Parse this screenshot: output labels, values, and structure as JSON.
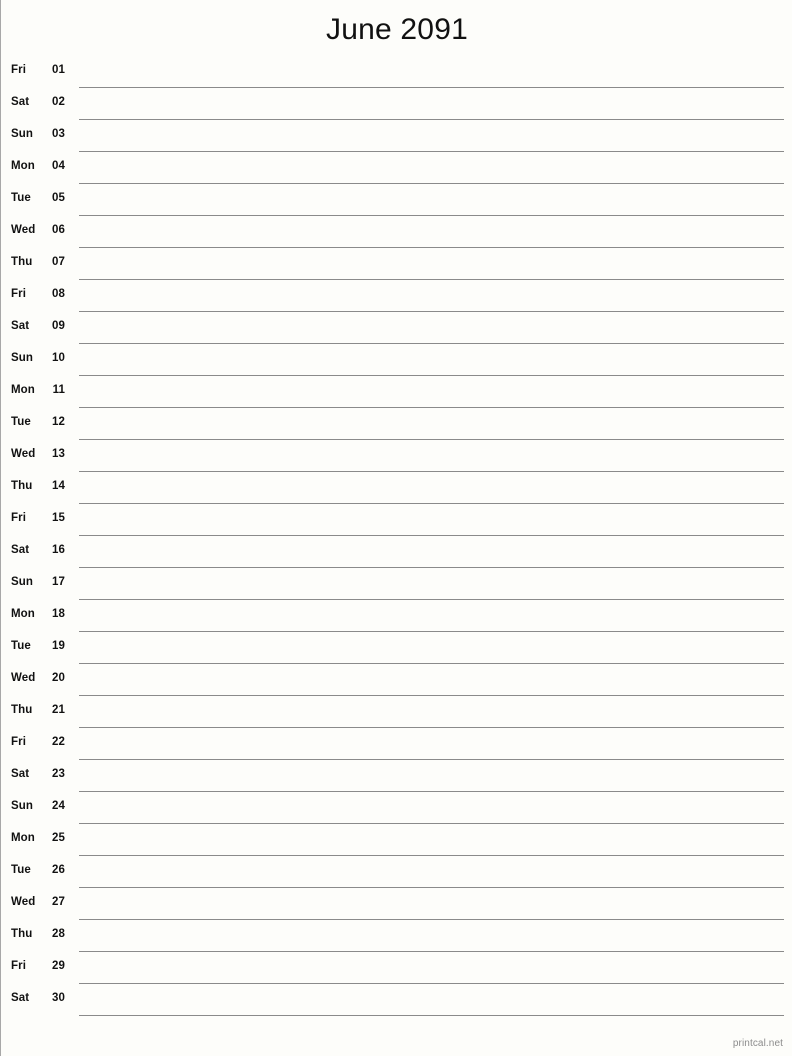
{
  "page": {
    "title": "June 2091",
    "background_color": "#fdfdfa",
    "rule_color": "#8a8a8a",
    "text_color": "#111111"
  },
  "footer": {
    "credit": "printcal.net",
    "color": "#8c8c8c"
  },
  "calendar": {
    "month": "June",
    "year": "2091",
    "days": [
      {
        "weekday": "Fri",
        "date": "01"
      },
      {
        "weekday": "Sat",
        "date": "02"
      },
      {
        "weekday": "Sun",
        "date": "03"
      },
      {
        "weekday": "Mon",
        "date": "04"
      },
      {
        "weekday": "Tue",
        "date": "05"
      },
      {
        "weekday": "Wed",
        "date": "06"
      },
      {
        "weekday": "Thu",
        "date": "07"
      },
      {
        "weekday": "Fri",
        "date": "08"
      },
      {
        "weekday": "Sat",
        "date": "09"
      },
      {
        "weekday": "Sun",
        "date": "10"
      },
      {
        "weekday": "Mon",
        "date": "11"
      },
      {
        "weekday": "Tue",
        "date": "12"
      },
      {
        "weekday": "Wed",
        "date": "13"
      },
      {
        "weekday": "Thu",
        "date": "14"
      },
      {
        "weekday": "Fri",
        "date": "15"
      },
      {
        "weekday": "Sat",
        "date": "16"
      },
      {
        "weekday": "Sun",
        "date": "17"
      },
      {
        "weekday": "Mon",
        "date": "18"
      },
      {
        "weekday": "Tue",
        "date": "19"
      },
      {
        "weekday": "Wed",
        "date": "20"
      },
      {
        "weekday": "Thu",
        "date": "21"
      },
      {
        "weekday": "Fri",
        "date": "22"
      },
      {
        "weekday": "Sat",
        "date": "23"
      },
      {
        "weekday": "Sun",
        "date": "24"
      },
      {
        "weekday": "Mon",
        "date": "25"
      },
      {
        "weekday": "Tue",
        "date": "26"
      },
      {
        "weekday": "Wed",
        "date": "27"
      },
      {
        "weekday": "Thu",
        "date": "28"
      },
      {
        "weekday": "Fri",
        "date": "29"
      },
      {
        "weekday": "Sat",
        "date": "30"
      }
    ]
  }
}
